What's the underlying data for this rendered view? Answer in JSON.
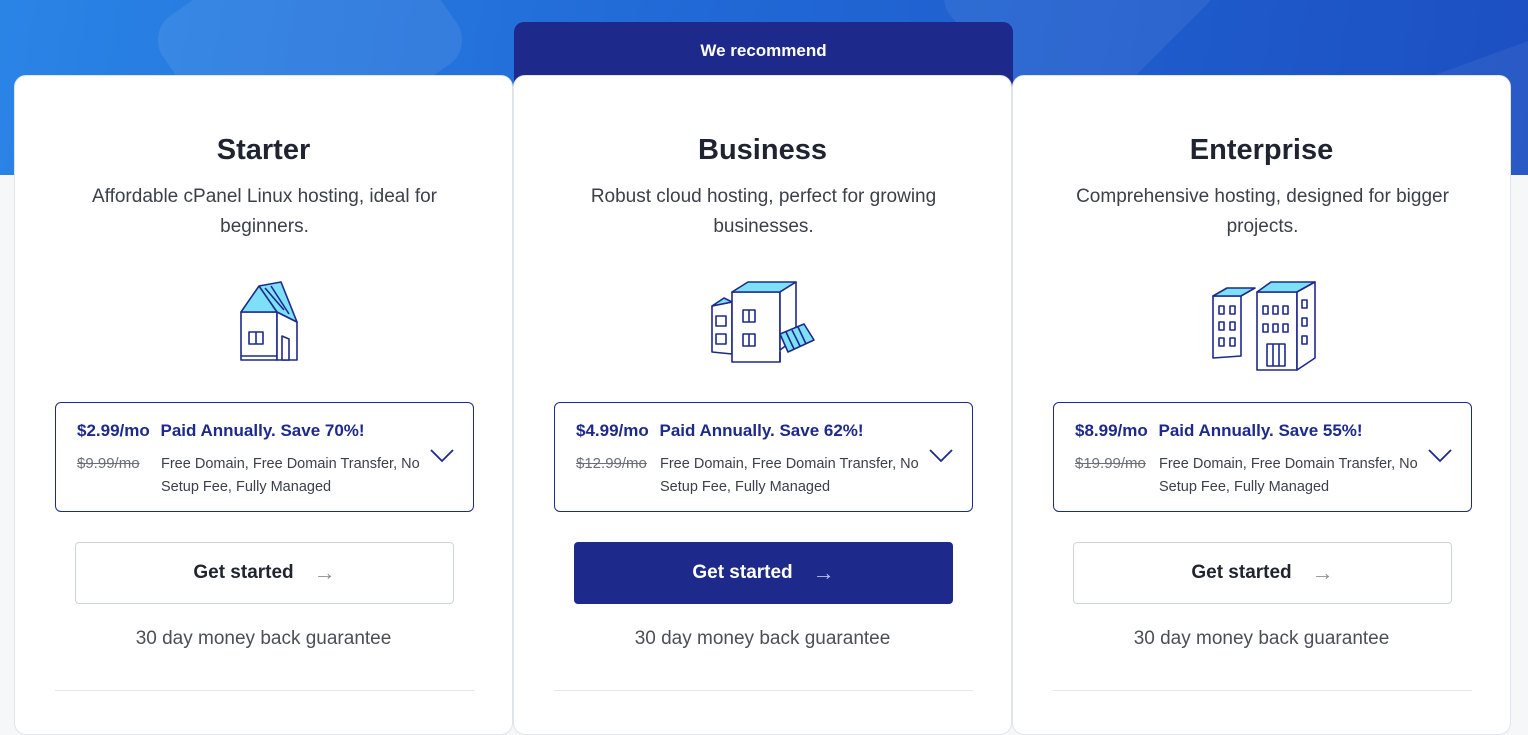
{
  "recommend_label": "We recommend",
  "plans": [
    {
      "name": "Starter",
      "description": "Affordable cPanel Linux hosting, ideal for beginners.",
      "price": "$2.99/mo",
      "billing": "Paid Annually. Save 70%!",
      "old_price": "$9.99/mo",
      "features": "Free Domain, Free Domain Transfer, No Setup Fee, Fully Managed",
      "cta": "Get started",
      "guarantee": "30 day money back guarantee",
      "illustration": "house-icon"
    },
    {
      "name": "Business",
      "description": "Robust cloud hosting, perfect for growing businesses.",
      "price": "$4.99/mo",
      "billing": "Paid Annually. Save 62%!",
      "old_price": "$12.99/mo",
      "features": "Free Domain, Free Domain Transfer, No Setup Fee, Fully Managed",
      "cta": "Get started",
      "guarantee": "30 day money back guarantee",
      "illustration": "shop-building-icon"
    },
    {
      "name": "Enterprise",
      "description": "Comprehensive hosting, designed for bigger projects.",
      "price": "$8.99/mo",
      "billing": "Paid Annually. Save 55%!",
      "old_price": "$19.99/mo",
      "features": "Free Domain, Free Domain Transfer, No Setup Fee, Fully Managed",
      "cta": "Get started",
      "guarantee": "30 day money back guarantee",
      "illustration": "office-buildings-icon"
    }
  ],
  "colors": {
    "brand_navy": "#1d2a8c",
    "hero_blue": "#2169d6",
    "illustration_fill": "#7ee0f7"
  }
}
